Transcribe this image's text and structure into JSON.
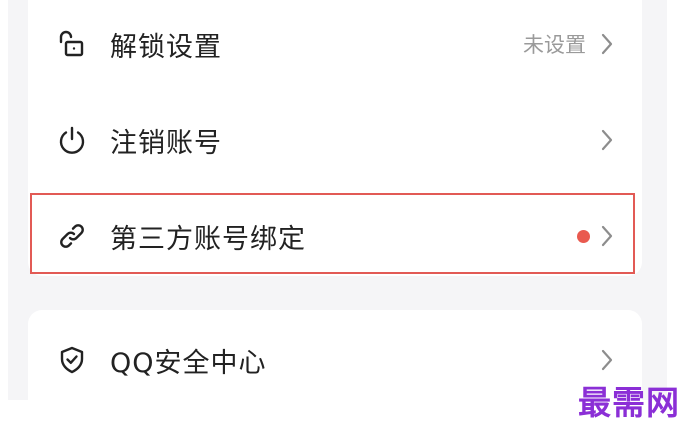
{
  "menu": {
    "items": [
      {
        "label": "解锁设置",
        "value": "未设置",
        "icon": "unlock-icon"
      },
      {
        "label": "注销账号",
        "icon": "power-icon"
      },
      {
        "label": "第三方账号绑定",
        "icon": "link-icon",
        "badge": "red-dot",
        "highlighted": true
      },
      {
        "label": "QQ安全中心",
        "icon": "shield-check-icon"
      }
    ]
  },
  "colors": {
    "highlight_border": "#e25a55",
    "badge_dot": "#e95a4f",
    "watermark": "#8b2fd6"
  },
  "watermark": {
    "text": "最需网"
  }
}
